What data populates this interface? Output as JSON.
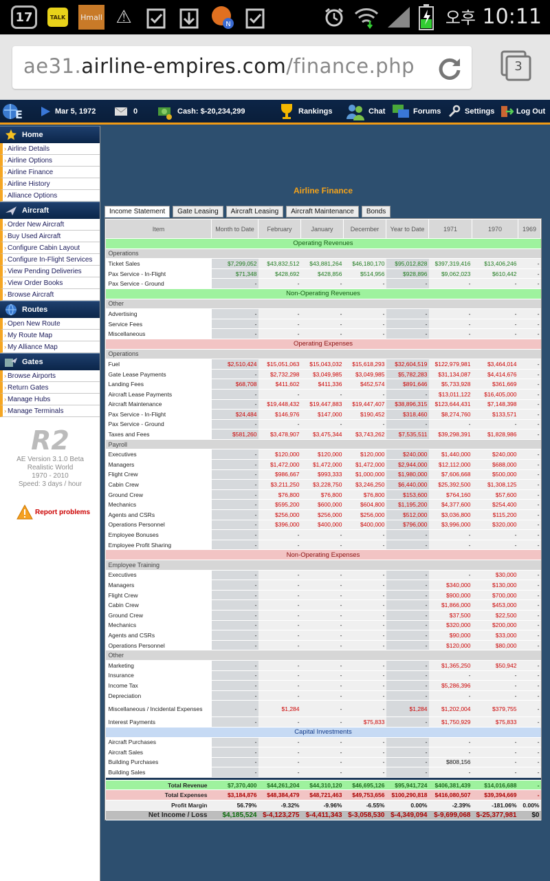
{
  "statusbar": {
    "notif_badge": "17",
    "talk_label": "TALK",
    "hmall_label": "Hmall",
    "lunar": "오후",
    "time": "10:11"
  },
  "browser": {
    "url_prefix": "ae31.",
    "url_host": "airline-empires.com",
    "url_path": "/finance.php",
    "tabs_count": "3"
  },
  "topnav": {
    "date": "Mar 5, 1972",
    "messages": "0",
    "cash": "Cash: $-20,234,299",
    "rankings": "Rankings",
    "chat": "Chat",
    "forums": "Forums",
    "settings": "Settings",
    "logout": "Log Out"
  },
  "sidebar": {
    "sections": [
      {
        "title": "Home",
        "icon": "star-icon",
        "items": [
          "Airline Details",
          "Airline Options",
          "Airline Finance",
          "Airline History",
          "Alliance Options"
        ]
      },
      {
        "title": "Aircraft",
        "icon": "airplane-icon",
        "items": [
          "Order New Aircraft",
          "Buy Used Aircraft",
          "Configure Cabin Layout",
          "Configure In-Flight Services",
          "View Pending Deliveries",
          "View Order Books",
          "Browse Aircraft"
        ]
      },
      {
        "title": "Routes",
        "icon": "globe-icon",
        "items": [
          "Open New Route",
          "My Route Map",
          "My Alliance Map"
        ]
      },
      {
        "title": "Gates",
        "icon": "gate-icon",
        "items": [
          "Browse Airports",
          "Return Gates",
          "Manage Hubs",
          "Manage Terminals"
        ]
      }
    ],
    "logo": "R2",
    "version": "AE Version 3.1.0 Beta",
    "world": "Realistic World",
    "years": "1970 - 2010",
    "speed": "Speed: 3 days / hour",
    "report": "Report problems"
  },
  "finance": {
    "title": "Airline Finance",
    "tabs": [
      "Income Statement",
      "Gate Leasing",
      "Aircraft Leasing",
      "Aircraft Maintenance",
      "Bonds"
    ],
    "columns": [
      "Item",
      "Month to Date",
      "February",
      "January",
      "December",
      "Year to Date",
      "1971",
      "1970",
      "1969"
    ],
    "rows": [
      {
        "type": "sec",
        "label": "Operating Revenues"
      },
      {
        "type": "sub",
        "label": "Operations"
      },
      {
        "label": "Ticket Sales",
        "vals": [
          "$7,299,052",
          "$43,832,512",
          "$43,881,264",
          "$46,180,170",
          "$95,012,828",
          "$397,319,416",
          "$13,406,246",
          "-"
        ],
        "color": "g"
      },
      {
        "label": "Pax Service - In-Flight",
        "vals": [
          "$71,348",
          "$428,692",
          "$428,856",
          "$514,956",
          "$928,896",
          "$9,062,023",
          "$610,442",
          "-"
        ],
        "color": "g"
      },
      {
        "label": "Pax Service - Ground",
        "vals": [
          "-",
          "-",
          "-",
          "-",
          "-",
          "-",
          "-",
          "-"
        ],
        "color": "g"
      },
      {
        "type": "sec",
        "label": "Non-Operating Revenues"
      },
      {
        "type": "sub",
        "label": "Other"
      },
      {
        "label": "Advertising",
        "vals": [
          "-",
          "-",
          "-",
          "-",
          "-",
          "-",
          "-",
          "-"
        ],
        "color": "g"
      },
      {
        "label": "Service Fees",
        "vals": [
          "-",
          "-",
          "-",
          "-",
          "-",
          "-",
          "-",
          "-"
        ],
        "color": "g"
      },
      {
        "label": "Miscellaneous",
        "vals": [
          "-",
          "-",
          "-",
          "-",
          "-",
          "-",
          "-",
          "-"
        ],
        "color": "g"
      },
      {
        "type": "sec exp",
        "label": "Operating Expenses"
      },
      {
        "type": "sub",
        "label": "Operations"
      },
      {
        "label": "Fuel",
        "vals": [
          "$2,510,424",
          "$15,051,063",
          "$15,043,032",
          "$15,618,293",
          "$32,604,519",
          "$122,979,981",
          "$3,464,014",
          "-"
        ]
      },
      {
        "label": "Gate Lease Payments",
        "vals": [
          "-",
          "$2,732,298",
          "$3,049,985",
          "$3,049,985",
          "$5,782,283",
          "$31,134,087",
          "$4,414,676",
          "-"
        ]
      },
      {
        "label": "Landing Fees",
        "vals": [
          "$68,708",
          "$411,602",
          "$411,336",
          "$452,574",
          "$891,646",
          "$5,733,928",
          "$361,669",
          "-"
        ]
      },
      {
        "label": "Aircraft Lease Payments",
        "vals": [
          "-",
          "-",
          "-",
          "-",
          "-",
          "$13,011,122",
          "$16,405,000",
          "-"
        ]
      },
      {
        "label": "Aircraft Maintenance",
        "vals": [
          "-",
          "$19,448,432",
          "$19,447,883",
          "$19,447,407",
          "$38,896,315",
          "$123,644,431",
          "$7,148,398",
          "-"
        ]
      },
      {
        "label": "Pax Service - In-Flight",
        "vals": [
          "$24,484",
          "$146,976",
          "$147,000",
          "$190,452",
          "$318,460",
          "$8,274,760",
          "$133,571",
          "-"
        ]
      },
      {
        "label": "Pax Service - Ground",
        "vals": [
          "-",
          "-",
          "-",
          "-",
          "-",
          "-",
          "-",
          "-"
        ]
      },
      {
        "label": "Taxes and Fees",
        "vals": [
          "$581,260",
          "$3,478,907",
          "$3,475,344",
          "$3,743,262",
          "$7,535,511",
          "$39,298,391",
          "$1,828,986",
          "-"
        ]
      },
      {
        "type": "sub",
        "label": "Payroll"
      },
      {
        "label": "Executives",
        "vals": [
          "-",
          "$120,000",
          "$120,000",
          "$120,000",
          "$240,000",
          "$1,440,000",
          "$240,000",
          "-"
        ]
      },
      {
        "label": "Managers",
        "vals": [
          "-",
          "$1,472,000",
          "$1,472,000",
          "$1,472,000",
          "$2,944,000",
          "$12,112,000",
          "$688,000",
          "-"
        ]
      },
      {
        "label": "Flight Crew",
        "vals": [
          "-",
          "$986,667",
          "$993,333",
          "$1,000,000",
          "$1,980,000",
          "$7,606,668",
          "$500,000",
          "-"
        ]
      },
      {
        "label": "Cabin Crew",
        "vals": [
          "-",
          "$3,211,250",
          "$3,228,750",
          "$3,246,250",
          "$6,440,000",
          "$25,392,500",
          "$1,308,125",
          "-"
        ]
      },
      {
        "label": "Ground Crew",
        "vals": [
          "-",
          "$76,800",
          "$76,800",
          "$76,800",
          "$153,600",
          "$764,160",
          "$57,600",
          "-"
        ]
      },
      {
        "label": "Mechanics",
        "vals": [
          "-",
          "$595,200",
          "$600,000",
          "$604,800",
          "$1,195,200",
          "$4,377,600",
          "$254,400",
          "-"
        ]
      },
      {
        "label": "Agents and CSRs",
        "vals": [
          "-",
          "$256,000",
          "$256,000",
          "$256,000",
          "$512,000",
          "$3,036,800",
          "$115,200",
          "-"
        ]
      },
      {
        "label": "Operations Personnel",
        "vals": [
          "-",
          "$396,000",
          "$400,000",
          "$400,000",
          "$796,000",
          "$3,996,000",
          "$320,000",
          "-"
        ]
      },
      {
        "label": "Employee Bonuses",
        "vals": [
          "-",
          "-",
          "-",
          "-",
          "-",
          "-",
          "-",
          "-"
        ]
      },
      {
        "label": "Employee Profit Sharing",
        "vals": [
          "-",
          "-",
          "-",
          "-",
          "-",
          "-",
          "-",
          "-"
        ]
      },
      {
        "type": "sec exp",
        "label": "Non-Operating Expenses"
      },
      {
        "type": "sub",
        "label": "Employee Training"
      },
      {
        "label": "Executives",
        "vals": [
          "-",
          "-",
          "-",
          "-",
          "-",
          "-",
          "$30,000",
          "-"
        ]
      },
      {
        "label": "Managers",
        "vals": [
          "-",
          "-",
          "-",
          "-",
          "-",
          "$340,000",
          "$130,000",
          "-"
        ]
      },
      {
        "label": "Flight Crew",
        "vals": [
          "-",
          "-",
          "-",
          "-",
          "-",
          "$900,000",
          "$700,000",
          "-"
        ]
      },
      {
        "label": "Cabin Crew",
        "vals": [
          "-",
          "-",
          "-",
          "-",
          "-",
          "$1,866,000",
          "$453,000",
          "-"
        ]
      },
      {
        "label": "Ground Crew",
        "vals": [
          "-",
          "-",
          "-",
          "-",
          "-",
          "$37,500",
          "$22,500",
          "-"
        ]
      },
      {
        "label": "Mechanics",
        "vals": [
          "-",
          "-",
          "-",
          "-",
          "-",
          "$320,000",
          "$200,000",
          "-"
        ]
      },
      {
        "label": "Agents and CSRs",
        "vals": [
          "-",
          "-",
          "-",
          "-",
          "-",
          "$90,000",
          "$33,000",
          "-"
        ]
      },
      {
        "label": "Operations Personnel",
        "vals": [
          "-",
          "-",
          "-",
          "-",
          "-",
          "$120,000",
          "$80,000",
          "-"
        ]
      },
      {
        "type": "sub",
        "label": "Other"
      },
      {
        "label": "Marketing",
        "vals": [
          "-",
          "-",
          "-",
          "-",
          "-",
          "$1,365,250",
          "$50,942",
          "-"
        ]
      },
      {
        "label": "Insurance",
        "vals": [
          "-",
          "-",
          "-",
          "-",
          "-",
          "-",
          "-",
          "-"
        ]
      },
      {
        "label": "Income Tax",
        "vals": [
          "-",
          "-",
          "-",
          "-",
          "-",
          "$5,286,396",
          "-",
          "-"
        ]
      },
      {
        "label": "Depreciation",
        "vals": [
          "-",
          "-",
          "-",
          "-",
          "-",
          "-",
          "-",
          "-"
        ]
      },
      {
        "label": "Miscellaneous / Incidental Expenses",
        "vals": [
          "-",
          "$1,284",
          "-",
          "-",
          "$1,284",
          "$1,202,004",
          "$379,755",
          "-"
        ],
        "tall": true
      },
      {
        "label": "Interest Payments",
        "vals": [
          "-",
          "-",
          "-",
          "$75,833",
          "-",
          "$1,750,929",
          "$75,833",
          "-"
        ]
      },
      {
        "type": "sec cap",
        "label": "Capital Investments"
      },
      {
        "label": "Aircraft Purchases",
        "vals": [
          "-",
          "-",
          "-",
          "-",
          "-",
          "-",
          "-",
          "-"
        ]
      },
      {
        "label": "Aircraft Sales",
        "vals": [
          "-",
          "-",
          "-",
          "-",
          "-",
          "-",
          "-",
          "-"
        ]
      },
      {
        "label": "Building Purchases",
        "vals": [
          "-",
          "-",
          "-",
          "-",
          "-",
          "$808,156",
          "-",
          "-"
        ],
        "color": "k"
      },
      {
        "label": "Building Sales",
        "vals": [
          "-",
          "-",
          "-",
          "-",
          "-",
          "-",
          "-",
          "-"
        ]
      },
      {
        "type": "spacer"
      },
      {
        "type": "tot rev",
        "label": "Total Revenue",
        "vals": [
          "$7,370,400",
          "$44,261,204",
          "$44,310,120",
          "$46,695,126",
          "$95,941,724",
          "$406,381,439",
          "$14,016,688",
          "-"
        ]
      },
      {
        "type": "tot texp",
        "label": "Total Expenses",
        "vals": [
          "$3,184,876",
          "$48,384,479",
          "$48,721,463",
          "$49,753,656",
          "$100,290,818",
          "$416,080,507",
          "$39,394,669",
          "-"
        ]
      },
      {
        "type": "tot marg",
        "label": "Profit Margin",
        "vals": [
          "56.79%",
          "-9.32%",
          "-9.96%",
          "-6.55%",
          "0.00%",
          "-2.39%",
          "-181.06%",
          "0.00%"
        ]
      },
      {
        "type": "tot net",
        "label": "Net Income / Loss",
        "vals": [
          "$4,185,524",
          "$-4,123,275",
          "$-4,411,343",
          "$-3,058,530",
          "$-4,349,094",
          "$-9,699,068",
          "$-25,377,981",
          "$0"
        ]
      }
    ]
  },
  "colors": {
    "nav_bg": "#0c2547",
    "accent_orange": "#f19a14",
    "page_bg": "#2d4f6f",
    "revenue_green": "#9ef29e",
    "expense_pink": "#f2c4c4",
    "capital_blue": "#c6daf4"
  }
}
